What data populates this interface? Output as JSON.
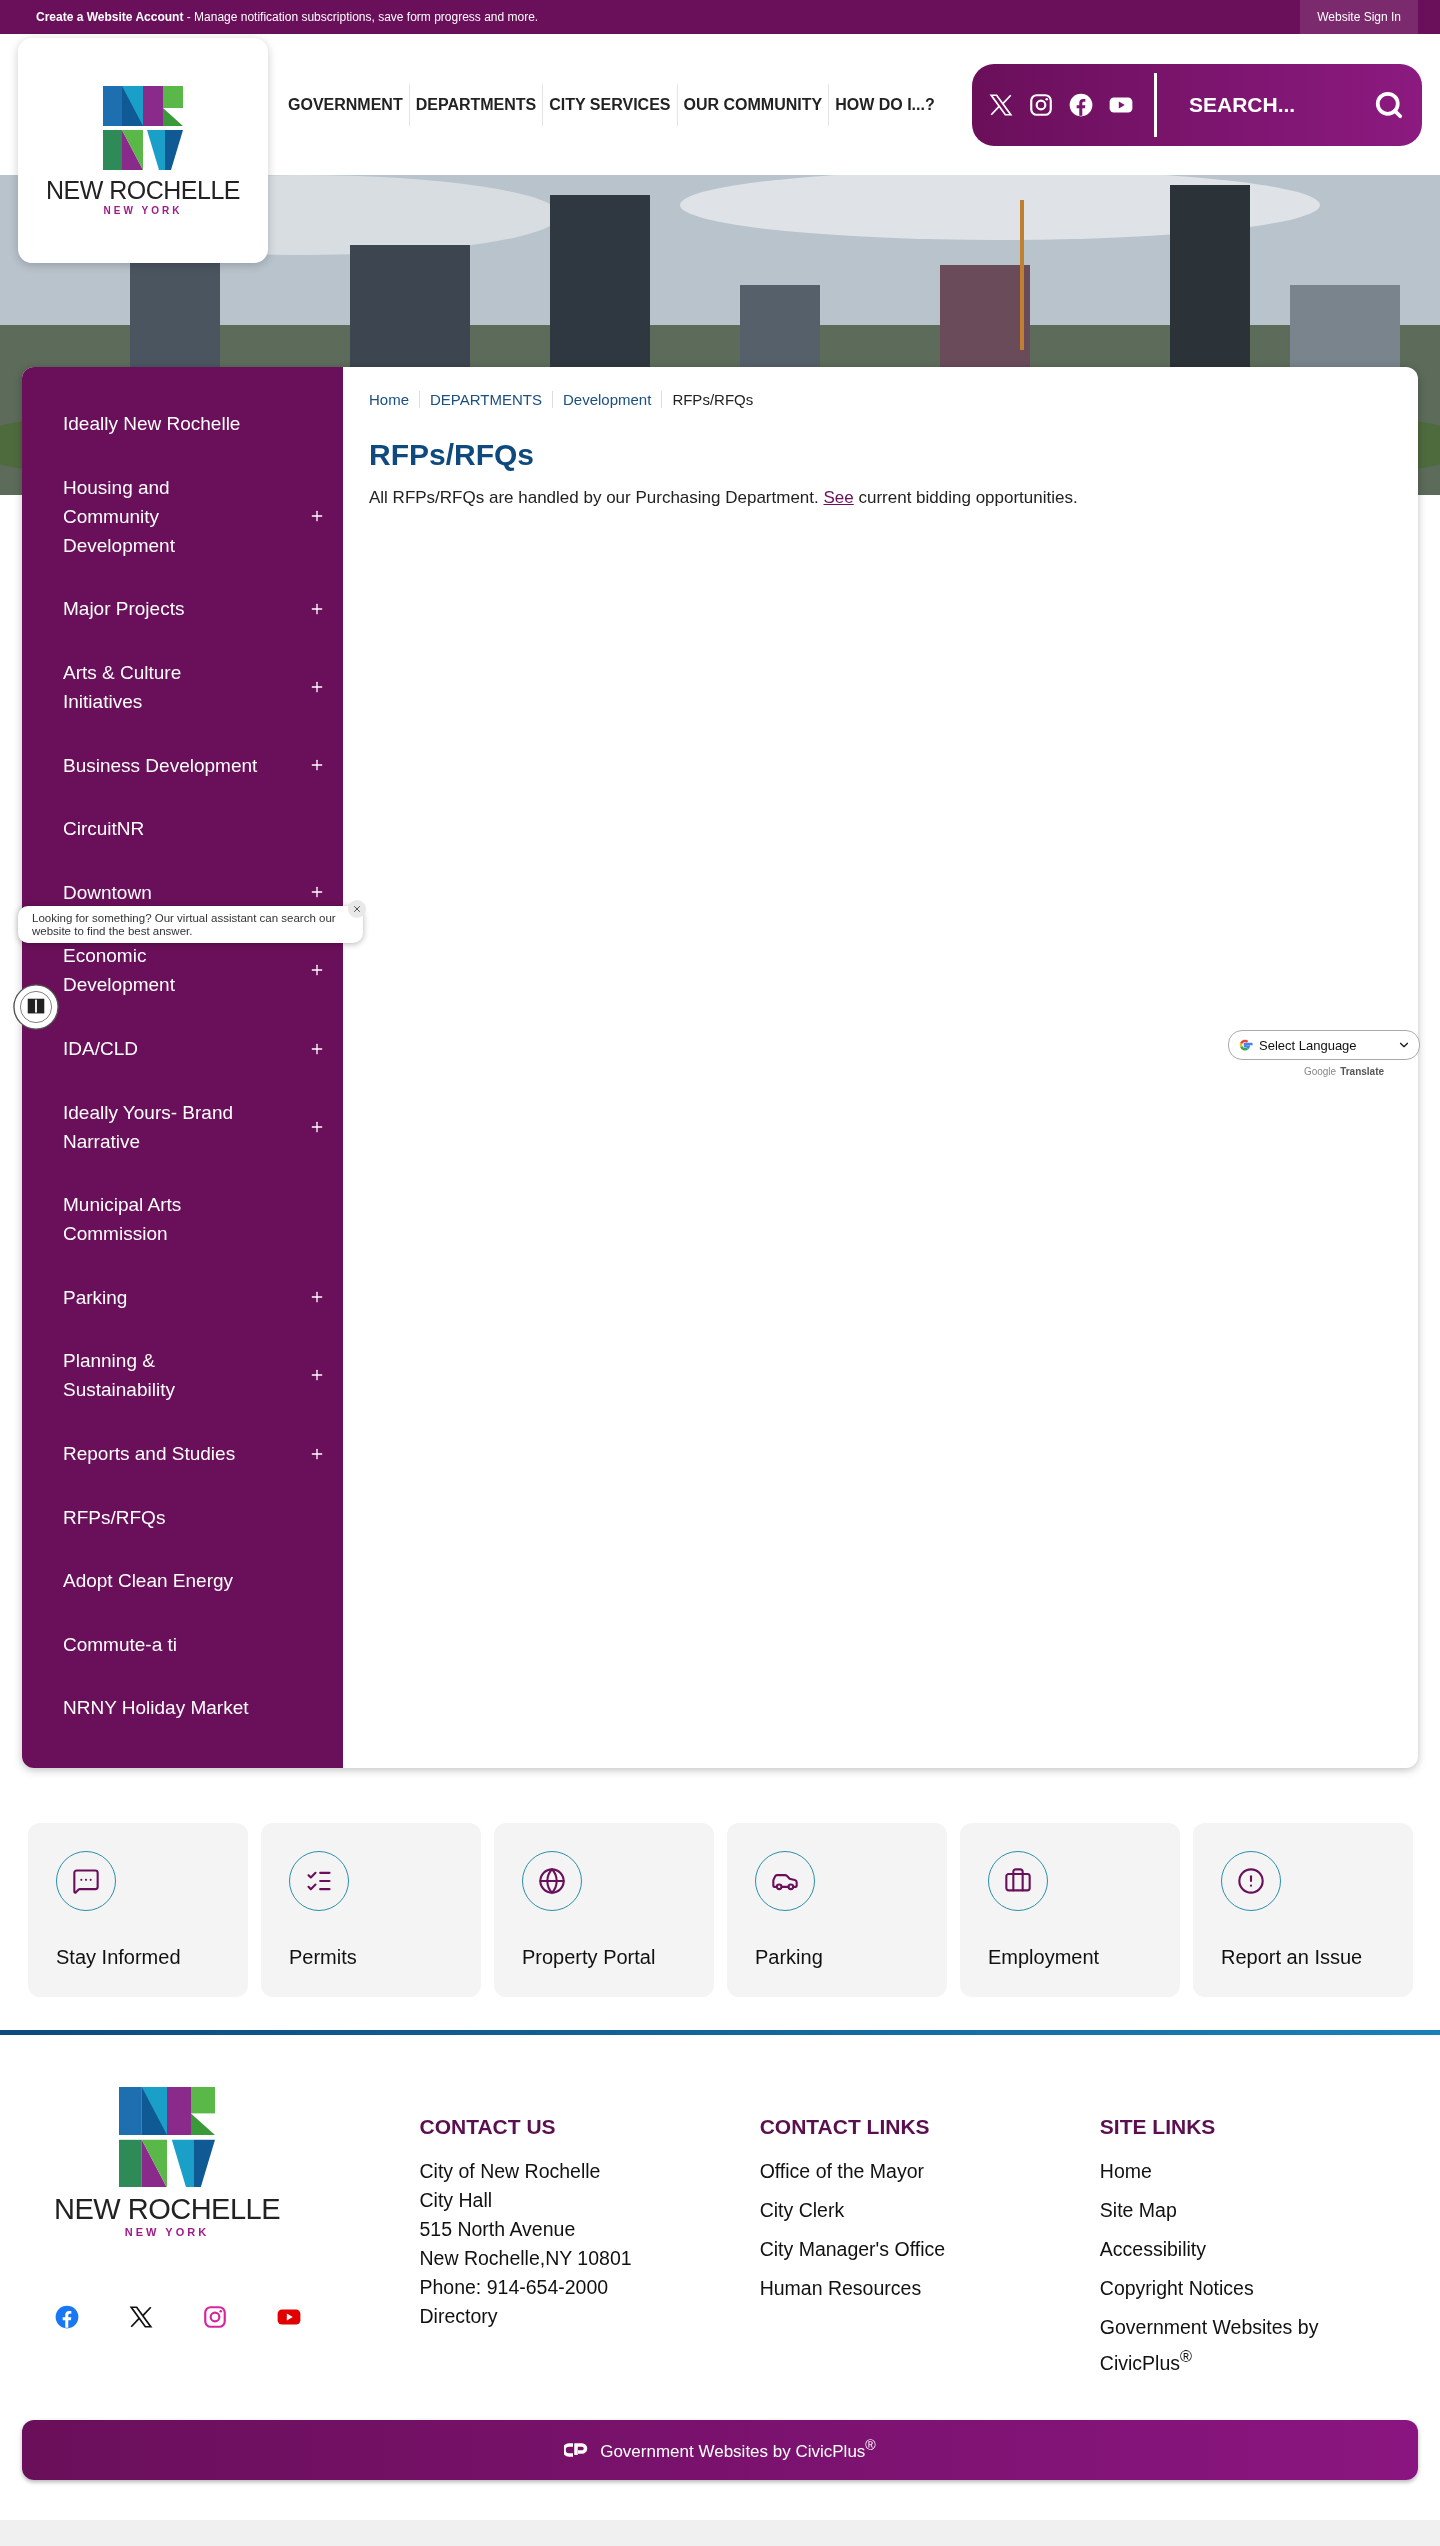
{
  "top_bar": {
    "message": "**Create a Website Account** - Manage notification subscriptions, save form progress and more.",
    "sign_in": "Website Sign In"
  },
  "logo": {
    "name": "NEW ROCHELLE",
    "state": "NEW YORK"
  },
  "nav": [
    "GOVERNMENT",
    "DEPARTMENTS",
    "CITY SERVICES",
    "OUR COMMUNITY",
    "HOW DO I...?"
  ],
  "search": {
    "placeholder": "SEARCH..."
  },
  "hero": {
    "kind": "picture"
  },
  "sidebar": {
    "items": [
      {
        "label": "Ideally New Rochelle",
        "expandable": false
      },
      {
        "label": "Housing and Community Development",
        "expandable": true
      },
      {
        "label": "Major Projects",
        "expandable": true
      },
      {
        "label": "Arts & Culture Initiatives",
        "expandable": true
      },
      {
        "label": "Business Development",
        "expandable": true
      },
      {
        "label": "CircuitNR",
        "expandable": false
      },
      {
        "label": "Downtown",
        "expandable": true
      },
      {
        "label": "Economic Development",
        "expandable": true
      },
      {
        "label": "IDA/CLD",
        "expandable": true
      },
      {
        "label": "Ideally Yours- Brand Narrative",
        "expandable": true
      },
      {
        "label": "Municipal Arts Commission",
        "expandable": false
      },
      {
        "label": "Parking",
        "expandable": true
      },
      {
        "label": "Planning & Sustainability",
        "expandable": true
      },
      {
        "label": "Reports and Studies",
        "expandable": true
      },
      {
        "label": "RFPs/RFQs",
        "expandable": false
      },
      {
        "label": "Adopt Clean Energy",
        "expandable": false
      },
      {
        "label": "Commute-a ti",
        "expandable": false
      },
      {
        "label": "NRNY Holiday Market",
        "expandable": false
      }
    ]
  },
  "breadcrumbs": [
    {
      "label": "Home",
      "current": false
    },
    {
      "label": "DEPARTMENTS",
      "current": false
    },
    {
      "label": "Development",
      "current": false
    },
    {
      "label": "RFPs/RFQs",
      "current": true
    }
  ],
  "page_title": "RFPs/RFQs",
  "body": {
    "before": "All RFPs/RFQs are handled by our Purchasing Department. ",
    "link": "See",
    "after": " current bidding opportunities."
  },
  "chat": {
    "message": "Looking for something? Our virtual assistant can search our website to find the best answer."
  },
  "translate": {
    "select": "Select Language",
    "brand": "Google",
    "label": "Translate"
  },
  "quick_links": [
    {
      "label": "Stay Informed",
      "kind": "chat"
    },
    {
      "label": "Permits",
      "kind": "checklist"
    },
    {
      "label": "Property Portal",
      "kind": "globe"
    },
    {
      "label": "Parking",
      "kind": "car"
    },
    {
      "label": "Employment",
      "kind": "briefcase"
    },
    {
      "label": "Report an Issue",
      "kind": "alert"
    }
  ],
  "footer": {
    "logo": {
      "name": "NEW ROCHELLE",
      "state": "NEW YORK"
    },
    "contact_us": {
      "heading": "CONTACT US",
      "lines": [
        "City of New Rochelle",
        "City Hall",
        "515 North Avenue",
        "New Rochelle,NY 10801",
        "Phone: 914-654-2000",
        "Directory"
      ]
    },
    "contact_links": {
      "heading": "CONTACT LINKS",
      "links": [
        "Office of the Mayor",
        "City Clerk",
        "City Manager's Office",
        "Human Resources"
      ]
    },
    "site_links": {
      "heading": "SITE LINKS",
      "links": [
        "Home",
        "Site Map",
        "Accessibility",
        "Copyright Notices",
        "Government Websites by CivicPlus$^{®}$"
      ]
    }
  },
  "bottom_bar": {
    "text": "Government Websites by CivicPlus$^{®}$"
  }
}
